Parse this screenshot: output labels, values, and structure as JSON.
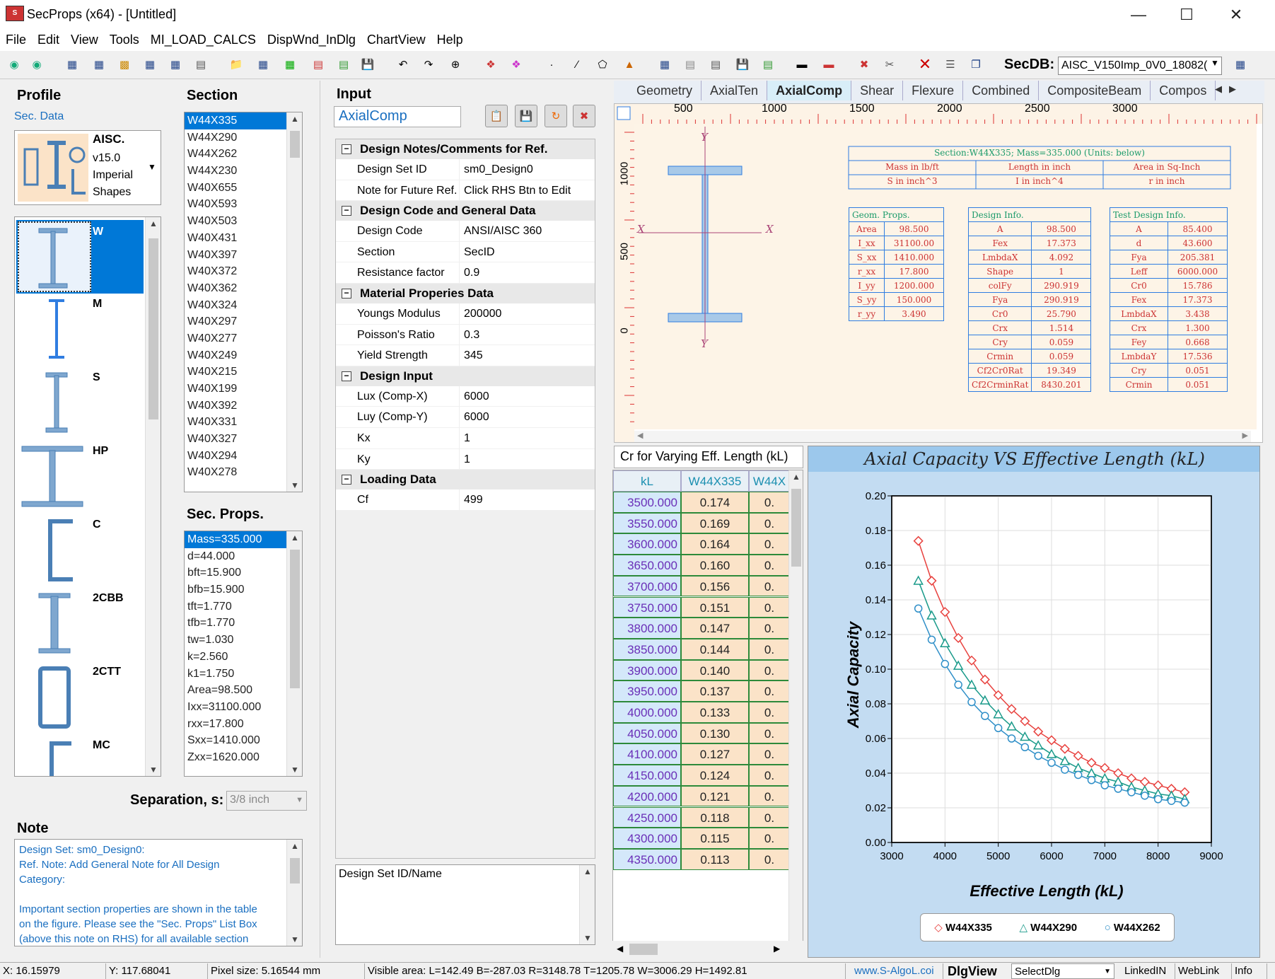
{
  "window": {
    "title": "SecProps (x64) - [Untitled]",
    "app_icon": "S"
  },
  "menu": [
    "File",
    "Edit",
    "View",
    "Tools",
    "MI_LOAD_CALCS",
    "DispWnd_InDlg",
    "ChartView",
    "Help"
  ],
  "secdb": {
    "label": "SecDB:",
    "value": "AISC_V150Imp_0V0_18082("
  },
  "profile": {
    "title": "Profile",
    "subtitle": "Sec. Data",
    "db_lines": [
      "AISC.",
      "v15.0",
      "Imperial",
      "Shapes"
    ],
    "shapes": [
      "W",
      "M",
      "S",
      "HP",
      "C",
      "2CBB",
      "2CTT",
      "MC"
    ]
  },
  "section": {
    "title": "Section",
    "items": [
      "W44X335",
      "W44X290",
      "W44X262",
      "W44X230",
      "W40X655",
      "W40X593",
      "W40X503",
      "W40X431",
      "W40X397",
      "W40X372",
      "W40X362",
      "W40X324",
      "W40X297",
      "W40X277",
      "W40X249",
      "W40X215",
      "W40X199",
      "W40X392",
      "W40X331",
      "W40X327",
      "W40X294",
      "W40X278"
    ]
  },
  "secprops": {
    "title": "Sec. Props.",
    "items": [
      "Mass=335.000",
      "d=44.000",
      "bft=15.900",
      "bfb=15.900",
      "tft=1.770",
      "tfb=1.770",
      "tw=1.030",
      "k=2.560",
      "k1=1.750",
      "Area=98.500",
      "Ixx=31100.000",
      "rxx=17.800",
      "Sxx=1410.000",
      "Zxx=1620.000"
    ]
  },
  "separation": {
    "label": "Separation, s:",
    "value": "3/8 inch"
  },
  "note": {
    "title": "Note",
    "lines": [
      "Design Set: sm0_Design0:",
      "Ref. Note: Add General Note for All Design",
      "Category:",
      "",
      "Important section properties are shown in the table",
      "on the figure. Please see the \"Sec. Props\" List Box",
      "(above this note on RHS) for all available section"
    ]
  },
  "input": {
    "title": "Input",
    "name": "AxialComp",
    "groups": [
      {
        "title": "Design Notes/Comments for Ref.",
        "rows": [
          [
            "Design Set ID",
            "sm0_Design0"
          ],
          [
            "Note for Future Ref.",
            "Click RHS Btn to Edit"
          ]
        ]
      },
      {
        "title": "Design Code and General Data",
        "rows": [
          [
            "Design Code",
            "ANSI/AISC 360"
          ],
          [
            "Section",
            "SecID"
          ],
          [
            "Resistance factor",
            "0.9"
          ]
        ]
      },
      {
        "title": "Material Properies Data",
        "rows": [
          [
            "Youngs Modulus",
            "200000"
          ],
          [
            "Poisson's Ratio",
            "0.3"
          ],
          [
            "Yield Strength",
            "345"
          ]
        ]
      },
      {
        "title": "Design Input",
        "rows": [
          [
            "Lux (Comp-X)",
            "6000"
          ],
          [
            "Luy (Comp-Y)",
            "6000"
          ],
          [
            "Kx",
            "1"
          ],
          [
            "Ky",
            "1"
          ]
        ]
      },
      {
        "title": "Loading Data",
        "rows": [
          [
            "Cf",
            "499"
          ]
        ]
      }
    ],
    "desc": "Design Set ID/Name"
  },
  "tabs": [
    "Geometry",
    "AxialTen",
    "AxialComp",
    "Shear",
    "Flexure",
    "Combined",
    "CompositeBeam",
    "Compos"
  ],
  "ruler": {
    "top": [
      "500",
      "1000",
      "1500",
      "2000",
      "2500",
      "3000"
    ],
    "left": [
      "1000",
      "500",
      "0"
    ]
  },
  "drawing": {
    "axis_x": "X",
    "axis_y": "Y",
    "header": [
      "Section:W44X335; Mass=335.000 (Units: below)",
      "Mass in lb/ft",
      "Length in inch",
      "Area in Sq-Inch",
      "S in inch^3",
      "I in inch^4",
      "r in inch"
    ],
    "geom": {
      "title": "Geom. Props.",
      "rows": [
        [
          "Area",
          "98.500"
        ],
        [
          "I_xx",
          "31100.00"
        ],
        [
          "S_xx",
          "1410.000"
        ],
        [
          "r_xx",
          "17.800"
        ],
        [
          "I_yy",
          "1200.000"
        ],
        [
          "S_yy",
          "150.000"
        ],
        [
          "r_yy",
          "3.490"
        ]
      ]
    },
    "design": {
      "title": "Design Info.",
      "rows": [
        [
          "A",
          "98.500"
        ],
        [
          "Fex",
          "17.373"
        ],
        [
          "LmbdaX",
          "4.092"
        ],
        [
          "Shape",
          "1"
        ],
        [
          "colFy",
          "290.919"
        ],
        [
          "Fya",
          "290.919"
        ],
        [
          "Cr0",
          "25.790"
        ],
        [
          "Crx",
          "1.514"
        ],
        [
          "Cry",
          "0.059"
        ],
        [
          "Crmin",
          "0.059"
        ],
        [
          "Cf2Cr0Rat",
          "19.349"
        ],
        [
          "Cf2CrminRat",
          "8430.201"
        ]
      ]
    },
    "test": {
      "title": "Test Design Info.",
      "rows": [
        [
          "A",
          "85.400"
        ],
        [
          "d",
          "43.600"
        ],
        [
          "Fya",
          "205.381"
        ],
        [
          "Leff",
          "6000.000"
        ],
        [
          "Cr0",
          "15.786"
        ],
        [
          "Fex",
          "17.373"
        ],
        [
          "LmbdaX",
          "3.438"
        ],
        [
          "Crx",
          "1.300"
        ],
        [
          "Fey",
          "0.668"
        ],
        [
          "LmbdaY",
          "17.536"
        ],
        [
          "Cry",
          "0.051"
        ],
        [
          "Crmin",
          "0.051"
        ]
      ]
    }
  },
  "grid": {
    "title": "Cr for Varying Eff. Length (kL)",
    "headers": [
      "kL",
      "W44X335",
      "W44X"
    ],
    "rows": [
      [
        "3500.000",
        "0.174",
        "0."
      ],
      [
        "3550.000",
        "0.169",
        "0."
      ],
      [
        "3600.000",
        "0.164",
        "0."
      ],
      [
        "3650.000",
        "0.160",
        "0."
      ],
      [
        "3700.000",
        "0.156",
        "0."
      ],
      [
        "3750.000",
        "0.151",
        "0."
      ],
      [
        "3800.000",
        "0.147",
        "0."
      ],
      [
        "3850.000",
        "0.144",
        "0."
      ],
      [
        "3900.000",
        "0.140",
        "0."
      ],
      [
        "3950.000",
        "0.137",
        "0."
      ],
      [
        "4000.000",
        "0.133",
        "0."
      ],
      [
        "4050.000",
        "0.130",
        "0."
      ],
      [
        "4100.000",
        "0.127",
        "0."
      ],
      [
        "4150.000",
        "0.124",
        "0."
      ],
      [
        "4200.000",
        "0.121",
        "0."
      ],
      [
        "4250.000",
        "0.118",
        "0."
      ],
      [
        "4300.000",
        "0.115",
        "0."
      ],
      [
        "4350.000",
        "0.113",
        "0."
      ]
    ]
  },
  "chart_data": {
    "type": "line",
    "title": "Axial Capacity VS Effective Length (kL)",
    "xlabel": "Effective Length (kL)",
    "ylabel": "Axial Capacity",
    "xlim": [
      3000,
      9000
    ],
    "ylim": [
      0,
      0.2
    ],
    "xticks": [
      "3000",
      "4000",
      "5000",
      "6000",
      "7000",
      "8000",
      "9000"
    ],
    "yticks": [
      "0.00",
      "0.02",
      "0.04",
      "0.06",
      "0.08",
      "0.10",
      "0.12",
      "0.14",
      "0.16",
      "0.18",
      "0.20"
    ],
    "grid": true,
    "legend": "bottom",
    "x": [
      3500,
      3750,
      4000,
      4250,
      4500,
      4750,
      5000,
      5250,
      5500,
      5750,
      6000,
      6250,
      6500,
      6750,
      7000,
      7250,
      7500,
      7750,
      8000,
      8250,
      8500
    ],
    "series": [
      {
        "name": "W44X335",
        "color": "#e8423f",
        "marker": "diamond",
        "values": [
          0.174,
          0.151,
          0.133,
          0.118,
          0.105,
          0.094,
          0.085,
          0.077,
          0.07,
          0.064,
          0.059,
          0.054,
          0.05,
          0.046,
          0.043,
          0.04,
          0.037,
          0.035,
          0.033,
          0.031,
          0.029
        ]
      },
      {
        "name": "W44X290",
        "color": "#1a9a8a",
        "marker": "triangle",
        "values": [
          0.151,
          0.131,
          0.115,
          0.102,
          0.091,
          0.082,
          0.074,
          0.067,
          0.061,
          0.056,
          0.051,
          0.047,
          0.043,
          0.04,
          0.037,
          0.035,
          0.032,
          0.03,
          0.028,
          0.027,
          0.025
        ]
      },
      {
        "name": "W44X262",
        "color": "#2f8fc8",
        "marker": "circle",
        "values": [
          0.135,
          0.117,
          0.103,
          0.091,
          0.081,
          0.073,
          0.066,
          0.06,
          0.055,
          0.05,
          0.046,
          0.042,
          0.039,
          0.036,
          0.033,
          0.031,
          0.029,
          0.027,
          0.025,
          0.024,
          0.023
        ]
      }
    ]
  },
  "status": {
    "x": "X: 16.15979",
    "y": "Y: 117.68041",
    "pixel": "Pixel size: 5.16544 mm",
    "visible": "Visible area:  L=142.49  B=-287.03  R=3148.78  T=1205.78   W=3006.29  H=1492.81",
    "web": "www.S-AlgoL.coi",
    "dlgview_label": "DlgView",
    "dlgview_value": "SelectDlg",
    "linkedin": "LinkedIN",
    "weblink": "WebLink",
    "info": "Info"
  }
}
